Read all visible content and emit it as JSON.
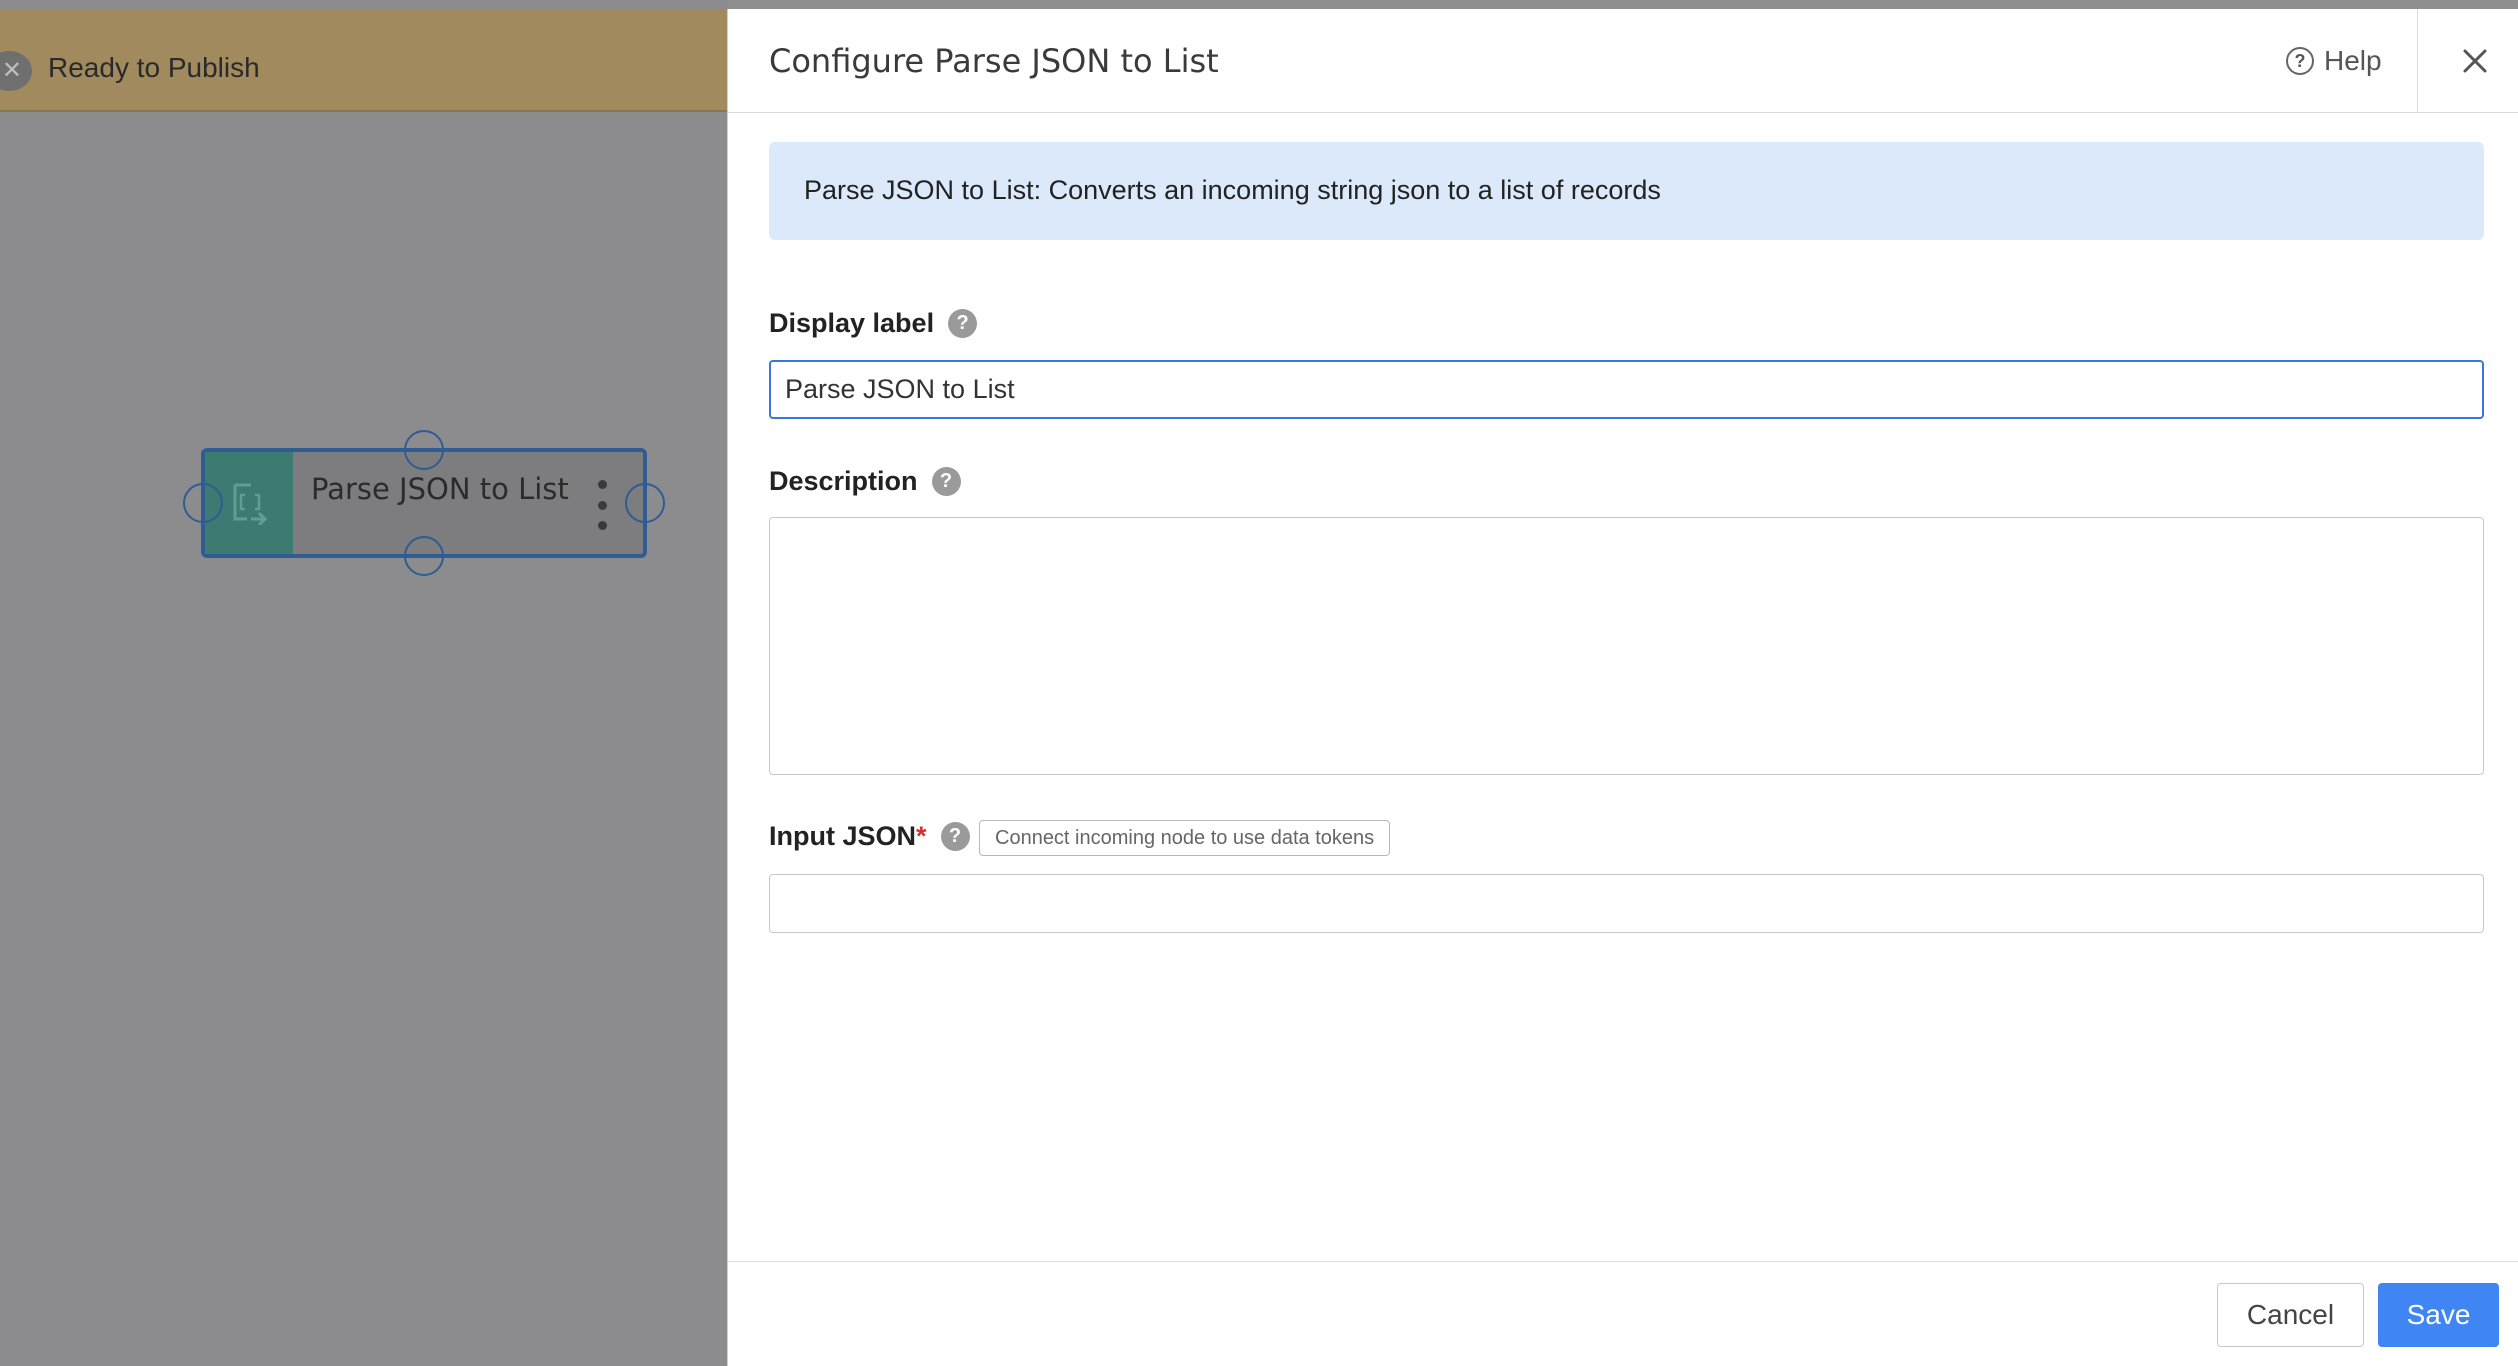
{
  "banner": {
    "text": "Ready to Publish",
    "close_symbol": "✕"
  },
  "node": {
    "label": "Parse JSON to List",
    "icon": "parse-json-list-icon",
    "icon_bg": "#3d7a72",
    "border_color": "#2f5c93"
  },
  "panel": {
    "title": "Configure Parse JSON to List",
    "help_label": "Help",
    "help_symbol": "?",
    "info_text": "Parse JSON to List: Converts an incoming string json to a list of records",
    "display_label": {
      "label": "Display label",
      "value": "Parse JSON to List"
    },
    "description": {
      "label": "Description",
      "value": ""
    },
    "input_json": {
      "label": "Input JSON",
      "required_marker": "*",
      "hint": "Connect incoming node to use data tokens",
      "value": ""
    },
    "question_symbol": "?"
  },
  "footer": {
    "cancel_label": "Cancel",
    "save_label": "Save"
  },
  "colors": {
    "accent": "#3f86f4",
    "banner": "#a08a5e",
    "info_bg": "#dbe9fb",
    "required": "#d32f2f"
  }
}
